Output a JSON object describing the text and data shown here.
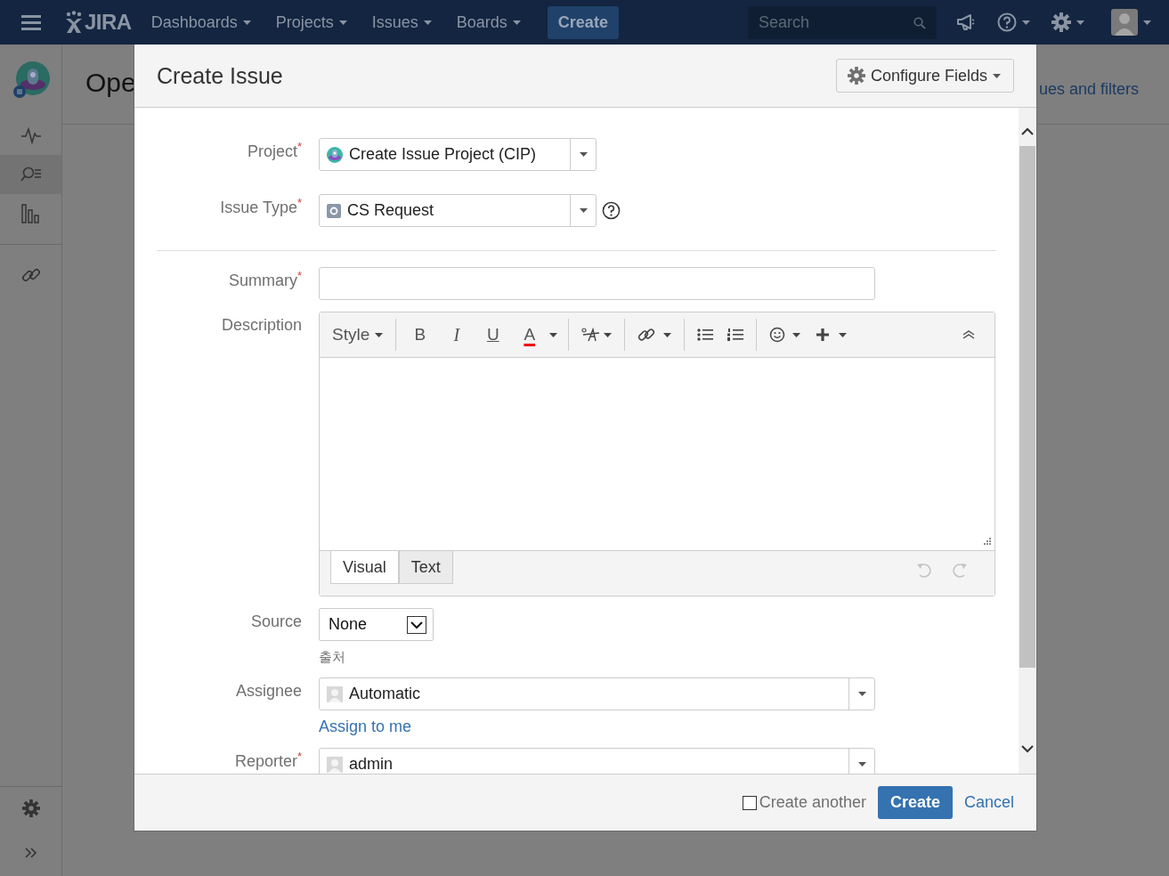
{
  "header": {
    "logo": "JIRA",
    "nav": [
      {
        "label": "Dashboards"
      },
      {
        "label": "Projects"
      },
      {
        "label": "Issues"
      },
      {
        "label": "Boards"
      }
    ],
    "create": "Create",
    "search": {
      "placeholder": "Search"
    }
  },
  "sidebar": {
    "items": [
      {
        "selected": false
      },
      {
        "selected": true
      },
      {
        "selected": false
      }
    ]
  },
  "page": {
    "title": "Ope",
    "link": "ues and filters"
  },
  "dialog": {
    "title": "Create Issue",
    "configure": "Configure Fields",
    "required_mark": "*",
    "fields": [
      {
        "kind": "project",
        "label": "Project",
        "required": true,
        "value": "Create Issue Project (CIP)"
      },
      {
        "kind": "issuetype",
        "label": "Issue Type",
        "required": true,
        "value": "CS Request"
      },
      {
        "kind": "divider"
      },
      {
        "kind": "text",
        "label": "Summary",
        "required": true
      },
      {
        "kind": "editor",
        "label": "Description",
        "required": false,
        "style": "Style",
        "format": [
          "B",
          "I",
          "U",
          "A"
        ],
        "tabs": [
          {
            "label": "Visual",
            "selected": true
          },
          {
            "label": "Text",
            "selected": false
          }
        ]
      },
      {
        "kind": "select",
        "label": "Source",
        "required": false,
        "value": "None",
        "hint": "출처"
      },
      {
        "kind": "user",
        "label": "Assignee",
        "required": false,
        "value": "Automatic",
        "link": "Assign to me"
      },
      {
        "kind": "user",
        "label": "Reporter",
        "required": true,
        "value": "admin"
      }
    ],
    "create_another": {
      "label": "Create another",
      "checked": false
    },
    "submit": "Create",
    "cancel": "Cancel"
  }
}
